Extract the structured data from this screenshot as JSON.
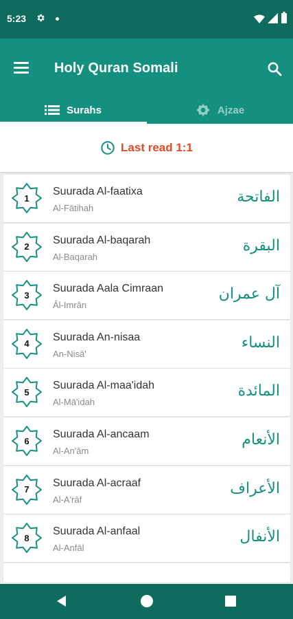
{
  "status_bar": {
    "time": "5:23"
  },
  "app_bar": {
    "title": "Holy Quran Somali"
  },
  "tabs": [
    {
      "label": "Surahs",
      "selected": true
    },
    {
      "label": "Ajzae",
      "selected": false
    }
  ],
  "last_read": {
    "text": "Last read 1:1"
  },
  "colors": {
    "primary": "#15907f",
    "primary_dark": "#0e6b5e",
    "accent": "#e04a26"
  },
  "surahs": [
    {
      "number": "1",
      "name": "Suurada Al-faatixa",
      "translit": "Al-Fātihah",
      "arabic": "الفاتحة"
    },
    {
      "number": "2",
      "name": "Suurada Al-baqarah",
      "translit": "Al-Baqarah",
      "arabic": "البقرة"
    },
    {
      "number": "3",
      "name": "Suurada Aala Cimraan",
      "translit": "Āl-Imrān",
      "arabic": "آل عمران"
    },
    {
      "number": "4",
      "name": "Suurada An-nisaa",
      "translit": "An-Nisā'",
      "arabic": "النساء"
    },
    {
      "number": "5",
      "name": "Suurada Al-maa'idah",
      "translit": "Al-Mā'idah",
      "arabic": "المائدة"
    },
    {
      "number": "6",
      "name": "Suurada Al-ancaam",
      "translit": "Al-An'ām",
      "arabic": "الأنعام"
    },
    {
      "number": "7",
      "name": "Suurada Al-acraaf",
      "translit": "Al-A'rāf",
      "arabic": "الأعراف"
    },
    {
      "number": "8",
      "name": "Suurada Al-anfaal",
      "translit": "Al-Anfāl",
      "arabic": "الأنفال"
    }
  ]
}
